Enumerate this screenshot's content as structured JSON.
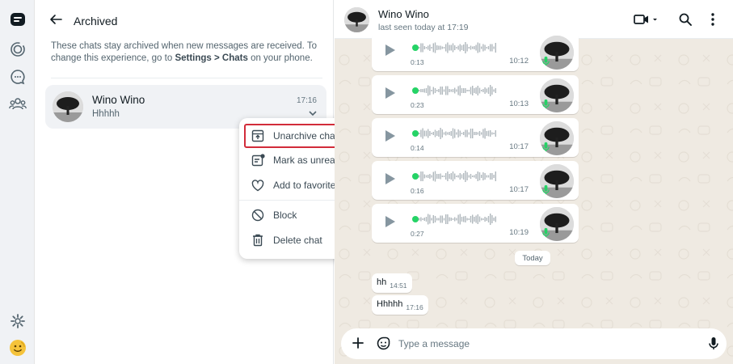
{
  "archived_panel": {
    "title": "Archived",
    "note_text": "These chats stay archived when new messages are received. To change this experience, go to ",
    "note_bold": "Settings > Chats",
    "note_tail": " on your phone.",
    "chat": {
      "name": "Wino Wino",
      "preview": "Hhhhh",
      "time": "17:16"
    }
  },
  "context_menu": {
    "items": [
      {
        "label": "Unarchive chat",
        "icon": "unarchive-icon"
      },
      {
        "label": "Mark as unread",
        "icon": "mark-unread-icon"
      },
      {
        "label": "Add to favorites",
        "icon": "heart-icon"
      },
      {
        "label": "Block",
        "icon": "block-icon"
      },
      {
        "label": "Delete chat",
        "icon": "trash-icon"
      }
    ],
    "highlight_color": "#d22c3a"
  },
  "conversation": {
    "contact_name": "Wino Wino",
    "status": "last seen today at 17:19",
    "voice_messages": [
      {
        "duration": "0:13",
        "time": "10:12"
      },
      {
        "duration": "0:23",
        "time": "10:13"
      },
      {
        "duration": "0:14",
        "time": "10:17"
      },
      {
        "duration": "0:16",
        "time": "10:17"
      },
      {
        "duration": "0:27",
        "time": "10:19"
      }
    ],
    "day_label": "Today",
    "text_messages": [
      {
        "text": "hh",
        "time": "14:51"
      },
      {
        "text": "Hhhhh",
        "time": "17:16"
      }
    ],
    "compose_placeholder": "Type a message"
  },
  "colors": {
    "accent_green": "#25d366",
    "rail_bg": "#f0f2f5",
    "chat_bg": "#efeae2"
  }
}
